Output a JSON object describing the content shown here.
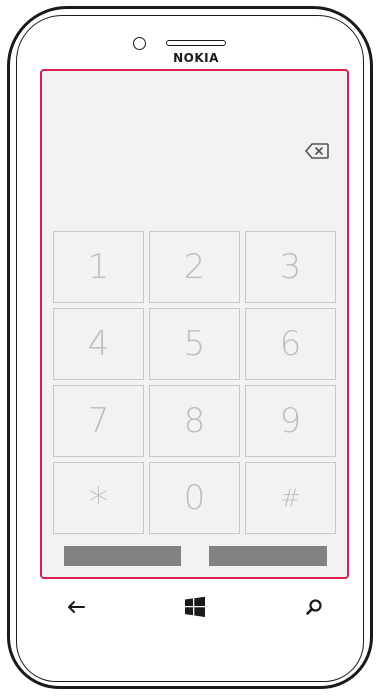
{
  "device": {
    "brand": "NOKIA",
    "frame_color": "#1a1a1a",
    "screen_border_color": "#d81f4e"
  },
  "dialer": {
    "backspace_icon": "backspace-icon",
    "keys": [
      {
        "label": "1"
      },
      {
        "label": "2"
      },
      {
        "label": "3"
      },
      {
        "label": "4"
      },
      {
        "label": "5"
      },
      {
        "label": "6"
      },
      {
        "label": "7"
      },
      {
        "label": "8"
      },
      {
        "label": "9"
      },
      {
        "label": "*"
      },
      {
        "label": "0"
      },
      {
        "label": "#"
      }
    ],
    "key_text_color": "#bdbdbd",
    "key_border_color": "#c8c8c8",
    "action_bar_color": "#828282"
  },
  "navigation": {
    "back_icon": "back-arrow-icon",
    "start_icon": "windows-logo-icon",
    "search_icon": "search-icon"
  }
}
